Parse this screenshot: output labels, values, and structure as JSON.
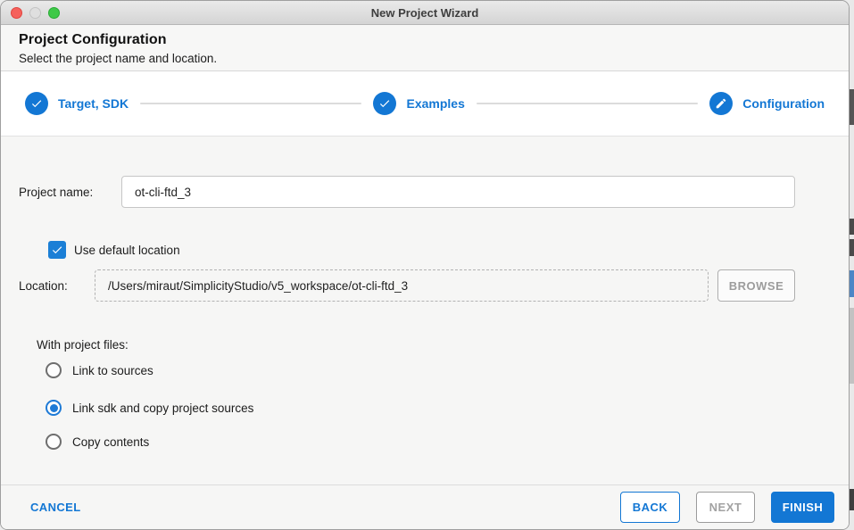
{
  "window": {
    "title": "New Project Wizard",
    "traffic_lights": [
      "close",
      "minimize",
      "zoom"
    ]
  },
  "header": {
    "title": "Project Configuration",
    "subtitle": "Select the project name and location."
  },
  "steps": [
    {
      "label": "Target, SDK",
      "icon": "check-icon",
      "state": "complete"
    },
    {
      "label": "Examples",
      "icon": "check-icon",
      "state": "complete"
    },
    {
      "label": "Configuration",
      "icon": "pencil-icon",
      "state": "current"
    }
  ],
  "form": {
    "project_name": {
      "label": "Project name:",
      "value": "ot-cli-ftd_3"
    },
    "use_default_location": {
      "label": "Use default location",
      "checked": true
    },
    "location": {
      "label": "Location:",
      "value": "/Users/miraut/SimplicityStudio/v5_workspace/ot-cli-ftd_3",
      "browse_label": "BROWSE"
    },
    "with_project_files": {
      "label": "With project files:",
      "options": [
        {
          "label": "Link to sources",
          "selected": false
        },
        {
          "label": "Link sdk and copy project sources",
          "selected": true
        },
        {
          "label": "Copy contents",
          "selected": false
        }
      ]
    }
  },
  "footer": {
    "cancel_label": "CANCEL",
    "back_label": "BACK",
    "next_label": "NEXT",
    "finish_label": "FINISH"
  },
  "colors": {
    "accent_blue": "#1377d4",
    "checkbox_blue": "#1b7fd6",
    "step_line_gray": "#dcdcdc"
  }
}
